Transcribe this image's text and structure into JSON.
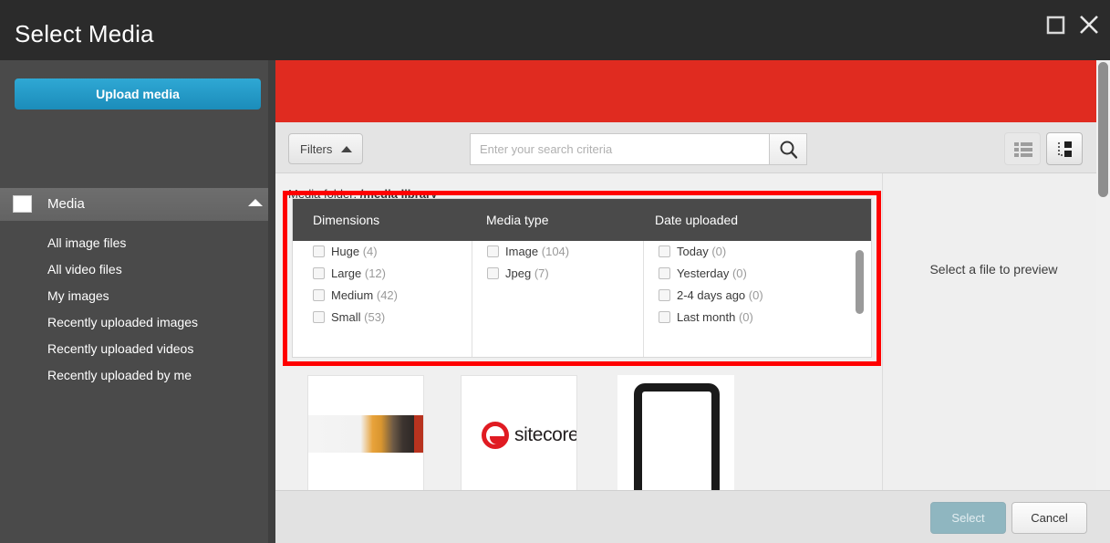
{
  "window": {
    "title": "Select Media",
    "maximize_icon": "maximize-icon",
    "close_icon": "close-icon"
  },
  "sidebar": {
    "upload_button": "Upload media",
    "section": {
      "label": "Media",
      "icon": "image-icon",
      "chevron": "chevron-up-icon"
    },
    "items": [
      {
        "label": "All image files"
      },
      {
        "label": "All video files"
      },
      {
        "label": "My images"
      },
      {
        "label": "Recently uploaded images"
      },
      {
        "label": "Recently uploaded videos"
      },
      {
        "label": "Recently uploaded by me"
      }
    ]
  },
  "toolbar": {
    "filters_label": "Filters",
    "filters_caret": "caret-up-icon",
    "search_placeholder": "Enter your search criteria",
    "search_value": "",
    "search_icon": "search-icon",
    "view_list_icon": "list-view-icon",
    "view_detail_icon": "detail-view-icon"
  },
  "breadcrumb": {
    "label": "Media folder:",
    "value": "/media library"
  },
  "filters": {
    "columns": [
      {
        "header": "Dimensions",
        "options": [
          {
            "label": "Huge",
            "count": "(4)"
          },
          {
            "label": "Large",
            "count": "(12)"
          },
          {
            "label": "Medium",
            "count": "(42)"
          },
          {
            "label": "Small",
            "count": "(53)"
          }
        ]
      },
      {
        "header": "Media type",
        "options": [
          {
            "label": "Image",
            "count": "(104)"
          },
          {
            "label": "Jpeg",
            "count": "(7)"
          }
        ]
      },
      {
        "header": "Date uploaded",
        "options": [
          {
            "label": "Today",
            "count": "(0)"
          },
          {
            "label": "Yesterday",
            "count": "(0)"
          },
          {
            "label": "2-4 days ago",
            "count": "(0)"
          },
          {
            "label": "Last month",
            "count": "(0)"
          }
        ]
      }
    ]
  },
  "thumbnails": [
    {
      "name": "photo-banner-thumbnail"
    },
    {
      "name": "sitecore-logo-thumbnail",
      "text": "sitecore"
    },
    {
      "name": "device-outline-thumbnail"
    }
  ],
  "preview": {
    "empty_text": "Select a file to preview"
  },
  "footer": {
    "select_label": "Select",
    "cancel_label": "Cancel"
  },
  "colors": {
    "titlebar": "#2b2b2b",
    "sidebar": "#4a4a4a",
    "accent_blue": "#1b8cba",
    "banner_red": "#e02b20",
    "annotation_red": "#ff0000",
    "select_disabled": "#8fb6c0"
  }
}
